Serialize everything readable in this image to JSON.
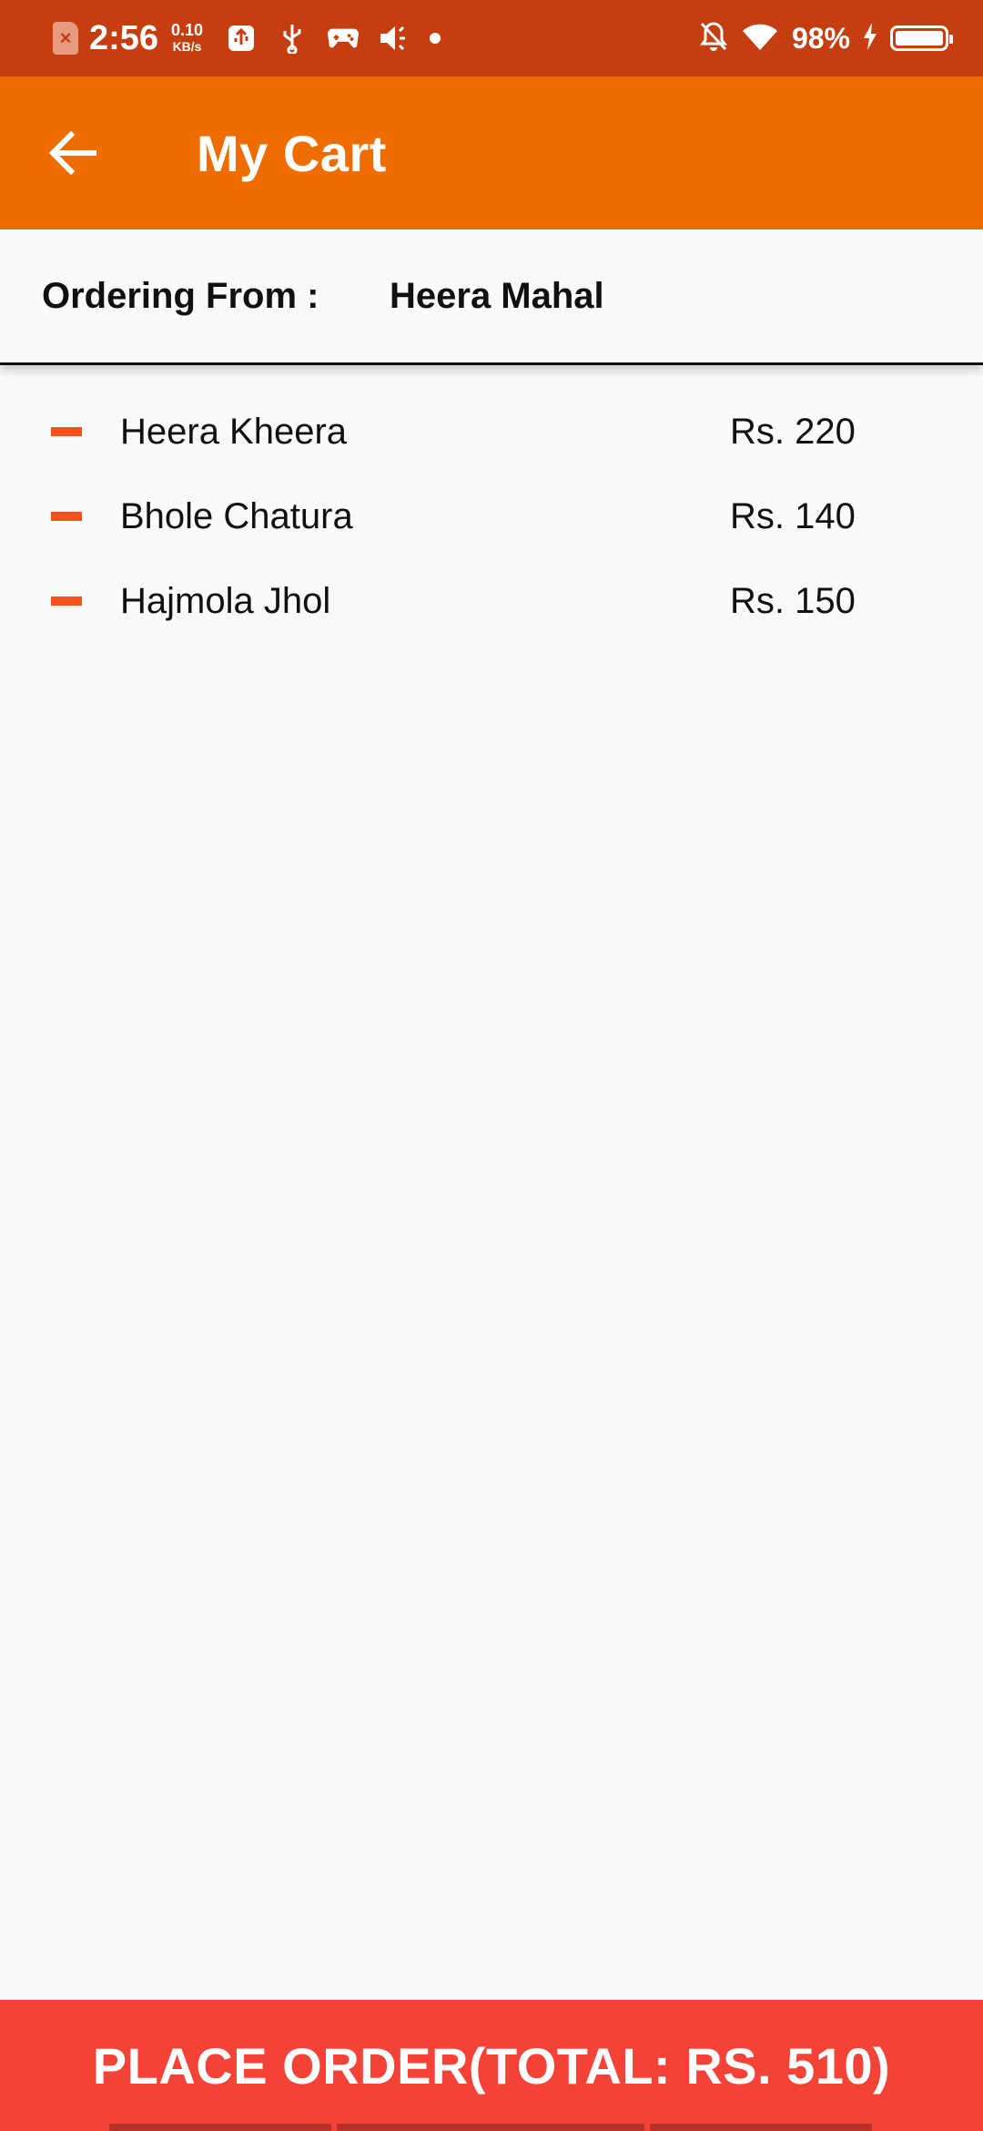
{
  "status_bar": {
    "time": "2:56",
    "speed_value": "0.10",
    "speed_unit": "KB/s",
    "battery": "98%",
    "icons": [
      "sim-error-icon",
      "usb-debug-icon",
      "usb-icon",
      "gamepad-icon",
      "mute-icon",
      "notification-dot-icon",
      "bell-off-icon",
      "wifi-icon",
      "charging-icon",
      "battery-icon"
    ]
  },
  "app_bar": {
    "title": "My Cart",
    "back_icon": "arrow-left-icon"
  },
  "ordering": {
    "label": "Ordering From :",
    "restaurant": "Heera Mahal"
  },
  "cart": {
    "items": [
      {
        "name": "Heera Kheera",
        "price": "Rs. 220"
      },
      {
        "name": "Bhole Chatura",
        "price": "Rs. 140"
      },
      {
        "name": "Hajmola Jhol",
        "price": "Rs. 150"
      }
    ]
  },
  "footer": {
    "place_order_label": "PLACE ORDER(TOTAL: RS. 510)"
  },
  "colors": {
    "status_bar": "#c43e10",
    "app_bar": "#ef6c00",
    "remove_accent": "#f4511e",
    "place_order": "#f44336",
    "background": "#fafafa"
  }
}
